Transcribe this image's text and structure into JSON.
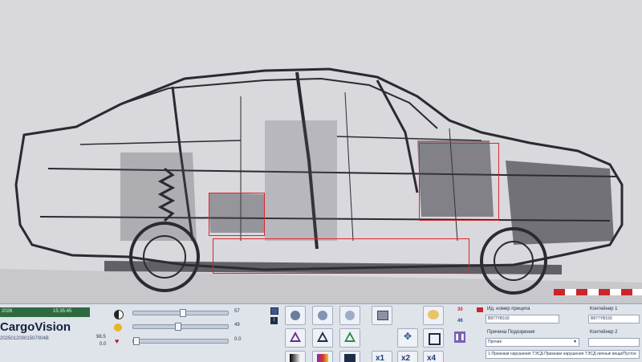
{
  "status": {
    "date": "2026",
    "time": "15:35:45"
  },
  "brand": "CargoVision",
  "serial": "20250120001507004B",
  "left_values": {
    "v1": "98.5",
    "v2": "0.0"
  },
  "sliders": [
    {
      "name": "brightness",
      "value": "57",
      "level": 0.5
    },
    {
      "name": "contrast",
      "value": "49",
      "level": 0.45
    },
    {
      "name": "gamma",
      "value": "0.0",
      "level": 0.0
    }
  ],
  "zoom_buttons": [
    "x1",
    "x2",
    "x4"
  ],
  "counters": {
    "top": "30",
    "middle": "46"
  },
  "form": {
    "container_number_label": "Ид. номер прицепа",
    "container_number_value": "B877YB193",
    "container1_label": "Контейнер 1",
    "container1_value": "B877YB193",
    "container2_label": "Контейнер 2",
    "suspicion_label": "Причина Подозрения",
    "suspicion_value": "Прочие",
    "note": "1-Признаки нарушения ТЭСД-Признаки нарушения ТЭСД-личные вещи/Пустое"
  },
  "colors": {
    "status_green": "#2e6a3f",
    "marker_red": "#d6282b",
    "stripe_red": "#c9262b"
  },
  "icons": [
    "contrast-icon",
    "sun-icon",
    "gamma-icon",
    "monitor-icon",
    "info-icon",
    "print-icon",
    "palette-icon",
    "move-icon",
    "crop-icon",
    "pause-icon",
    "color-scale-icon",
    "histogram-icon"
  ]
}
